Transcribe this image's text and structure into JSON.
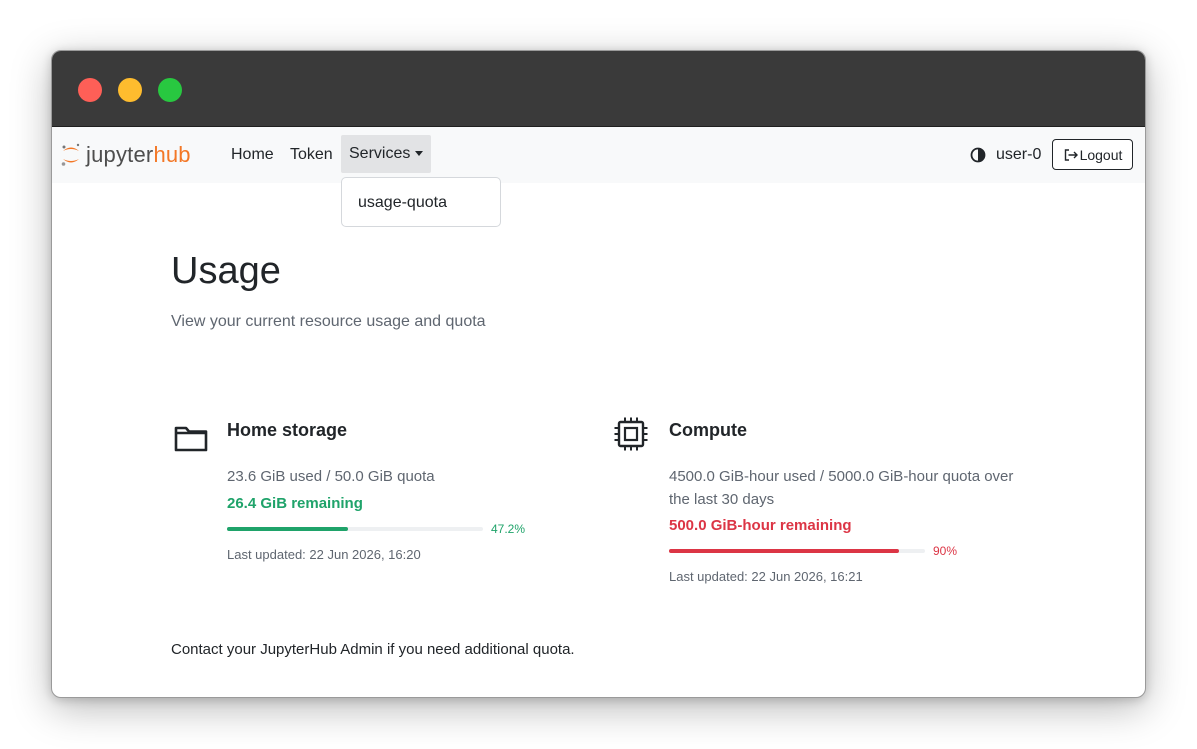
{
  "navbar": {
    "logo": {
      "part1": "jupyter",
      "part2": "hub"
    },
    "links": {
      "home": "Home",
      "token": "Token",
      "services": "Services"
    },
    "dropdown_items": [
      "usage-quota"
    ],
    "username": "user-0",
    "logout_label": "Logout"
  },
  "page": {
    "title": "Usage",
    "subtitle": "View your current resource usage and quota",
    "footer": "Contact your JupyterHub Admin if you need additional quota."
  },
  "cards": {
    "storage": {
      "icon": "folder-icon",
      "title": "Home storage",
      "usage_text": "23.6 GiB used / 50.0 GiB quota",
      "remaining": "26.4 GiB remaining",
      "percent_label": "47.2%",
      "percent_value": 47.2,
      "color": "#1fa36a",
      "last_updated": "Last updated: 22 Jun 2026, 16:20"
    },
    "compute": {
      "icon": "cpu-icon",
      "title": "Compute",
      "usage_text_line1": "4500.0 GiB-hour used / 5000.0 GiB-hour quota over",
      "usage_text_line2": "the last 30 days",
      "remaining": "500.0 GiB-hour remaining",
      "percent_label": "90%",
      "percent_value": 90,
      "color": "#dc3545",
      "last_updated": "Last updated: 22 Jun 2026, 16:21"
    }
  },
  "colors": {
    "brand_orange": "#f37726",
    "navbar_bg": "#f8f9fa",
    "titlebar_bg": "#3a3a3a"
  }
}
